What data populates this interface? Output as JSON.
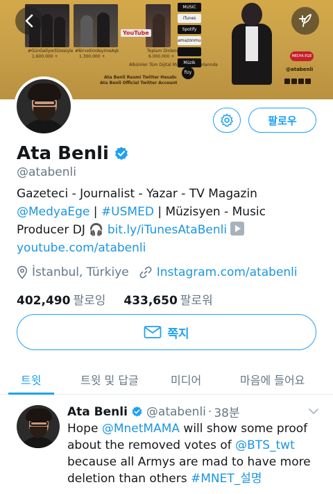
{
  "banner": {
    "caption_1": "#GünGeliyorDizesiyle",
    "count_1": "1.600.000 +",
    "caption_2": "#BirvetimdeyimeAşk",
    "count_2": "1.300.000 +",
    "youtube_label": "YouTube",
    "total_listens_label": "Toplam Dinlenme",
    "total_listens": "6.000.000 +",
    "platforms_note": "Albümler Tüm Dijital Müzik Platformlarında",
    "twitter_line_1": "Ata Benli Resmi Twitter Hesabı",
    "twitter_line_2": "Ata Benli Official Twitter Account",
    "stores": [
      "MUSIC",
      "iTunes",
      "Spotify",
      "amazonmusic",
      "",
      "Müzik"
    ],
    "fizy": "fizy",
    "medya": "MEDYA EGE",
    "handle": "@atabenli"
  },
  "profile": {
    "name": "Ata Benli",
    "handle": "@atabenli",
    "follow_label": "팔로우",
    "bio": {
      "line1": "Gazeteci - Journalist - Yazar - TV Magazin",
      "mention1": "@MedyaEge",
      "sep1": " | ",
      "hashtag1": "#USMED",
      "tail1": " | Müzisyen - Music",
      "line3_prefix": "Producer DJ ",
      "headphones": "🎧",
      "link1": "bit.ly/iTunesAtaBenli",
      "link2": "youtube.com/atabenli"
    },
    "location": "İstanbul, Türkiye",
    "website": "Instagram.com/atabenli",
    "following_count": "402,490",
    "following_label": "팔로잉",
    "followers_count": "433,650",
    "followers_label": "팔로워",
    "dm_label": "쪽지"
  },
  "tabs": [
    "트윗",
    "트윗 및 답글",
    "미디어",
    "마음에 들어요"
  ],
  "tweet": {
    "name": "Ata Benli",
    "handle": "@atabenli",
    "dot": "·",
    "time": "38분",
    "text_1": "Hope ",
    "mention_1": "@MnetMAMA",
    "text_2": " will show some proof about the removed votes of ",
    "mention_2": "@BTS_twt",
    "text_3": " because all Armys are mad to have more deletion than others ",
    "hashtag": "#MNET_설명"
  },
  "colors": {
    "accent": "#1da1f2",
    "link": "#1b95e0",
    "secondary_text": "#657786",
    "banner_gold": "#c9a04a"
  }
}
